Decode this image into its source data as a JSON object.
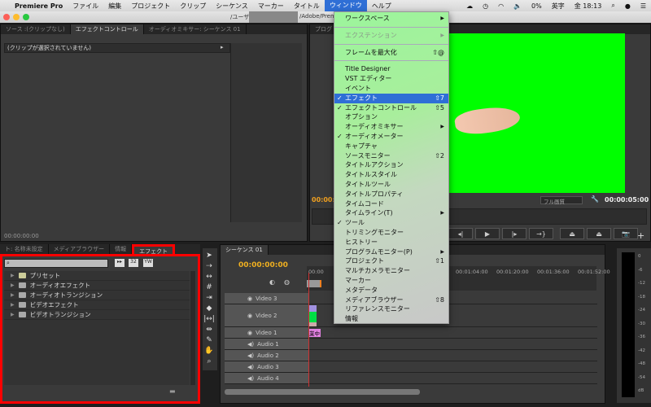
{
  "menubar": {
    "apple": "",
    "app": "Premiere Pro",
    "items": [
      "ファイル",
      "編集",
      "プロジェクト",
      "クリップ",
      "シーケンス",
      "マーカー",
      "タイトル",
      "ウィンドウ",
      "ヘルプ"
    ],
    "active": "ウィンドウ",
    "status": {
      "battery": "0%",
      "input": "英字",
      "clock": "金 18:13"
    }
  },
  "titlebar": {
    "text_left": "/ユーザ",
    "text_right": "/Adobe/Prem"
  },
  "source_panel": {
    "tabs": [
      "ソース :(クリップなし)",
      "エフェクトコントロール",
      "オーディオミキサー: シーケンス 01"
    ],
    "active_tab": "エフェクトコントロール",
    "message": "(クリップが選択されていません)",
    "timecode": "00:00:00:00"
  },
  "program_panel": {
    "tab": "プログ",
    "timecode_left": "00:00:",
    "quality": "フル画質",
    "timecode_right": "00:00:05:00",
    "screen_color": "#00ff00"
  },
  "project_panel": {
    "tabs": [
      "ト: 名称未設定",
      "メディアブラウザー",
      "情報",
      "エフェクト"
    ],
    "active_tab": "エフェクト",
    "search_placeholder": "",
    "icons": [
      "accelerated-icon",
      "32bit-icon",
      "yuv-icon"
    ],
    "items": [
      "プリセット",
      "オーディオエフェクト",
      "オーディオトランジション",
      "ビデオエフェクト",
      "ビデオトランジション"
    ],
    "highlight_color": "#ff0000"
  },
  "timeline": {
    "tab": "シーケンス 01",
    "timecode": "00:00:00:00",
    "ruler": [
      "00:00",
      "00:01:04:00",
      "00:01:20:00",
      "00:01:36:00",
      "00:01:52:00"
    ],
    "tracks": [
      "Video 3",
      "Video 2",
      "Video 1",
      "Audio 1",
      "Audio 2",
      "Audio 3",
      "Audio 4"
    ],
    "clip_label": "業中"
  },
  "audio_meter": {
    "scale": [
      "0",
      "-6",
      "-12",
      "-18",
      "-24",
      "-30",
      "-36",
      "-42",
      "-48",
      "-54",
      "dB"
    ]
  },
  "window_menu": {
    "items": [
      {
        "label": "ワークスペース",
        "submenu": true
      },
      {
        "sep": true
      },
      {
        "label": "エクステンション",
        "submenu": true,
        "disabled": true
      },
      {
        "sep": true
      },
      {
        "label": "フレームを最大化",
        "shortcut": "⇧@"
      },
      {
        "sep": true
      },
      {
        "label": "Title Designer"
      },
      {
        "label": "VST エディター"
      },
      {
        "label": "イベント"
      },
      {
        "label": "エフェクト",
        "checked": true,
        "shortcut": "⇧7",
        "selected": true
      },
      {
        "label": "エフェクトコントロール",
        "checked": true,
        "shortcut": "⇧5"
      },
      {
        "label": "オプション"
      },
      {
        "label": "オーディオミキサー",
        "submenu": true
      },
      {
        "label": "オーディオメーター",
        "checked": true
      },
      {
        "label": "キャプチャ"
      },
      {
        "label": "ソースモニター",
        "shortcut": "⇧2"
      },
      {
        "label": "タイトルアクション"
      },
      {
        "label": "タイトルスタイル"
      },
      {
        "label": "タイトルツール"
      },
      {
        "label": "タイトルプロパティ"
      },
      {
        "label": "タイムコード"
      },
      {
        "label": "タイムライン(T)",
        "submenu": true
      },
      {
        "label": "ツール",
        "checked": true
      },
      {
        "label": "トリミングモニター"
      },
      {
        "label": "ヒストリー"
      },
      {
        "label": "プログラムモニター(P)",
        "submenu": true
      },
      {
        "label": "プロジェクト",
        "shortcut": "⇧1"
      },
      {
        "label": "マルチカメラモニター"
      },
      {
        "label": "マーカー"
      },
      {
        "label": "メタデータ"
      },
      {
        "label": "メディアブラウザー",
        "shortcut": "⇧8"
      },
      {
        "label": "リファレンスモニター"
      },
      {
        "label": "情報"
      }
    ]
  }
}
